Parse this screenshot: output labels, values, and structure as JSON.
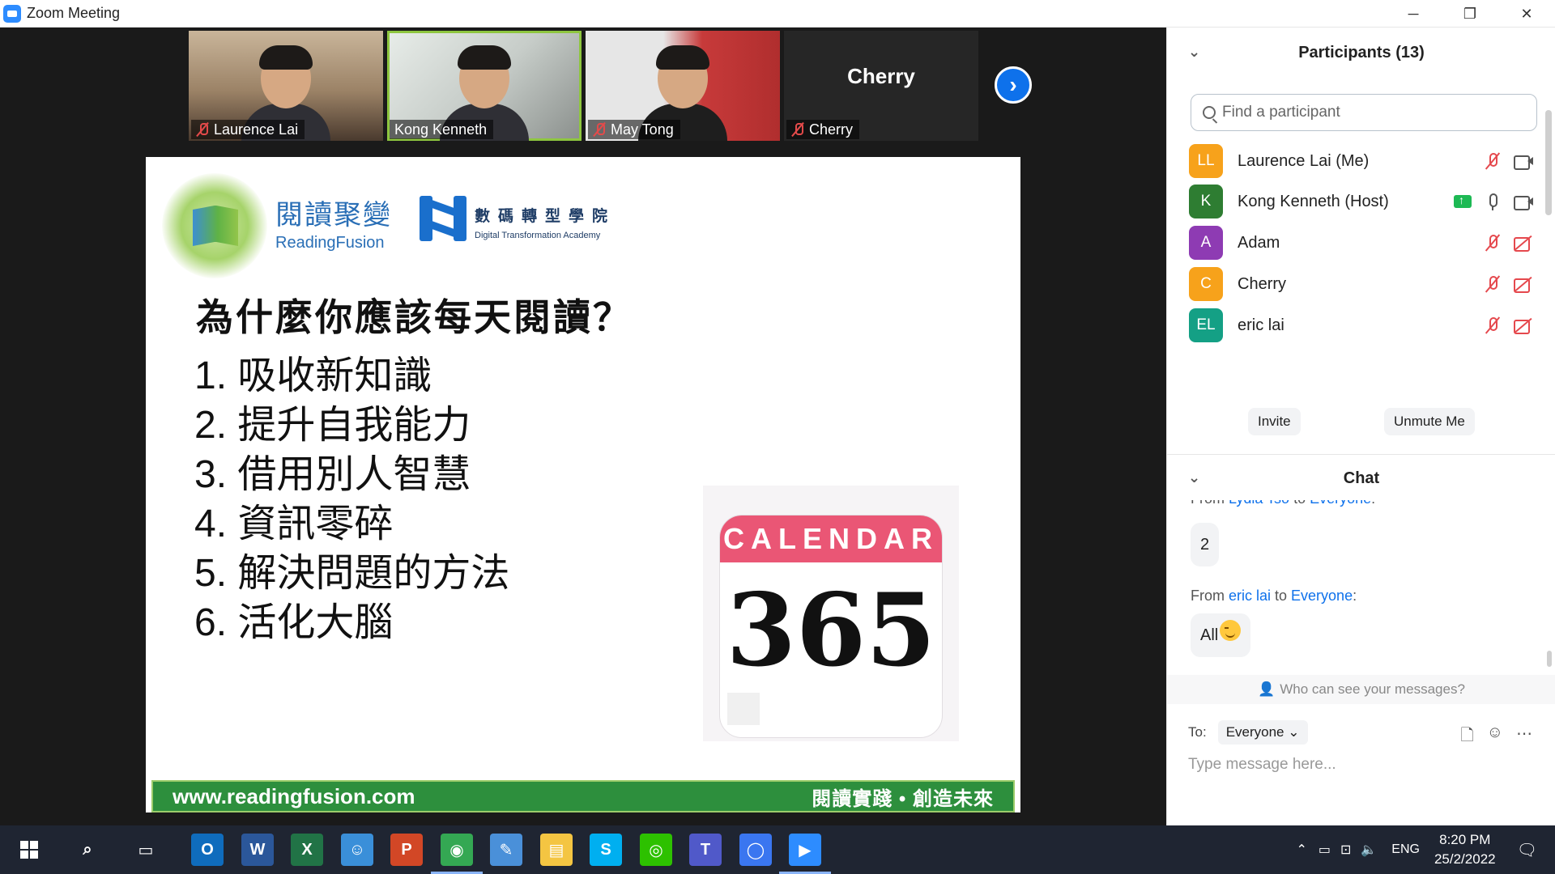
{
  "window": {
    "title": "Zoom Meeting",
    "controls": [
      "─",
      "❐",
      "✕"
    ]
  },
  "video_strip": {
    "tiles": [
      {
        "name": "Laurence Lai",
        "muted": true
      },
      {
        "name": "Kong Kenneth",
        "muted": false,
        "active_speaker": true
      },
      {
        "name": "May Tong",
        "muted": true
      },
      {
        "name": "Cherry",
        "muted": true,
        "video_off": true,
        "display_name": "Cherry"
      }
    ],
    "next_arrow": "›"
  },
  "slide": {
    "logo1_cn": "閱讀聚變",
    "logo1_en": "ReadingFusion",
    "logo2_cn": "數碼轉型學院",
    "logo2_en": "Digital Transformation Academy",
    "heading": "為什麼你應該每天閱讀？",
    "items": [
      "1. 吸收新知識",
      "2. 提升自我能力",
      "3. 借用別人智慧",
      "4. 資訊零碎",
      "5. 解決問題的方法",
      "6. 活化大腦"
    ],
    "calendar_header": "CALENDAR",
    "calendar_number": "365",
    "footer_url": "www.readingfusion.com",
    "footer_slogan": "閱讀實踐 • 創造未來"
  },
  "participants": {
    "header": "Participants (13)",
    "search_placeholder": "Find a participant",
    "list": [
      {
        "initials": "LL",
        "name": "Laurence Lai (Me)",
        "color": "#f7a21b",
        "mic": "off",
        "cam": "on"
      },
      {
        "initials": "K",
        "name": "Kong Kenneth (Host)",
        "color": "#2e7d32",
        "mic": "on",
        "cam": "on",
        "sharing": true
      },
      {
        "initials": "A",
        "name": "Adam",
        "color": "#8e3bb3",
        "mic": "off",
        "cam": "off"
      },
      {
        "initials": "C",
        "name": "Cherry",
        "color": "#f7a21b",
        "mic": "off",
        "cam": "off"
      },
      {
        "initials": "EL",
        "name": "eric lai",
        "color": "#14a085",
        "mic": "off",
        "cam": "off"
      }
    ],
    "invite_label": "Invite",
    "unmute_label": "Unmute Me"
  },
  "chat": {
    "header": "Chat",
    "messages": [
      {
        "from_prefix": "From ",
        "sender": "Lydia Tso",
        "to_word": " to ",
        "recipient": "Everyone",
        "suffix": ":",
        "text": "2"
      },
      {
        "from_prefix": "From ",
        "sender": "eric lai",
        "to_word": " to ",
        "recipient": "Everyone",
        "suffix": ":",
        "text": "All"
      }
    ],
    "who_can_see": "Who can see your messages?",
    "to_label": "To:",
    "to_value": "Everyone",
    "input_placeholder": "Type message here..."
  },
  "taskbar": {
    "time": "8:20 PM",
    "date": "25/2/2022",
    "lang": "ENG",
    "apps": [
      {
        "name": "outlook",
        "label": "O",
        "color": "#0f6cbd"
      },
      {
        "name": "word",
        "label": "W",
        "color": "#2b579a"
      },
      {
        "name": "excel",
        "label": "X",
        "color": "#217346"
      },
      {
        "name": "contacts",
        "label": "☺",
        "color": "#3a8fd9"
      },
      {
        "name": "powerpoint",
        "label": "P",
        "color": "#d24726"
      },
      {
        "name": "chrome",
        "label": "◉",
        "color": "#34a853"
      },
      {
        "name": "paint",
        "label": "✎",
        "color": "#4a90d9"
      },
      {
        "name": "explorer",
        "label": "▤",
        "color": "#f4c542"
      },
      {
        "name": "skype",
        "label": "S",
        "color": "#00aff0"
      },
      {
        "name": "wechat",
        "label": "◎",
        "color": "#2dc100"
      },
      {
        "name": "teams",
        "label": "T",
        "color": "#5059c9"
      },
      {
        "name": "signal",
        "label": "◯",
        "color": "#3a76f0"
      },
      {
        "name": "zoom",
        "label": "▶",
        "color": "#2d8cff"
      }
    ]
  }
}
